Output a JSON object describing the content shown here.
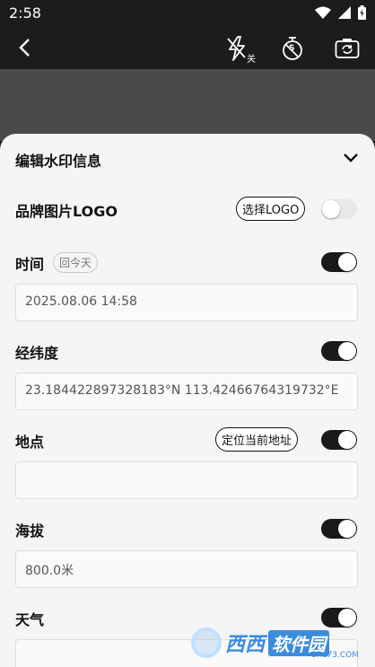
{
  "status_bar": {
    "time": "2:58"
  },
  "toolbar": {
    "flash_off_label": "关",
    "timer_label": "S"
  },
  "sheet": {
    "title": "编辑水印信息",
    "logo_row": {
      "label": "品牌图片LOGO",
      "button": "选择LOGO",
      "enabled": false
    },
    "time_row": {
      "label": "时间",
      "chip": "回今天",
      "enabled": true,
      "value": "2025.08.06 14:58"
    },
    "coords_row": {
      "label": "经纬度",
      "enabled": true,
      "value": "23.184422897328183°N 113.42466764319732°E"
    },
    "location_row": {
      "label": "地点",
      "button": "定位当前地址",
      "enabled": true,
      "value": ""
    },
    "altitude_row": {
      "label": "海拔",
      "enabled": true,
      "value": "800.0米"
    },
    "weather_row": {
      "label": "天气",
      "enabled": true
    }
  },
  "watermark": {
    "text1": "西西",
    "text2": "软件园",
    "url": "CR173.COM"
  },
  "colors": {
    "accent": "#1a1a1a",
    "sheet_bg": "#f5f5f5",
    "topbar_bg": "#1c1c1c"
  }
}
